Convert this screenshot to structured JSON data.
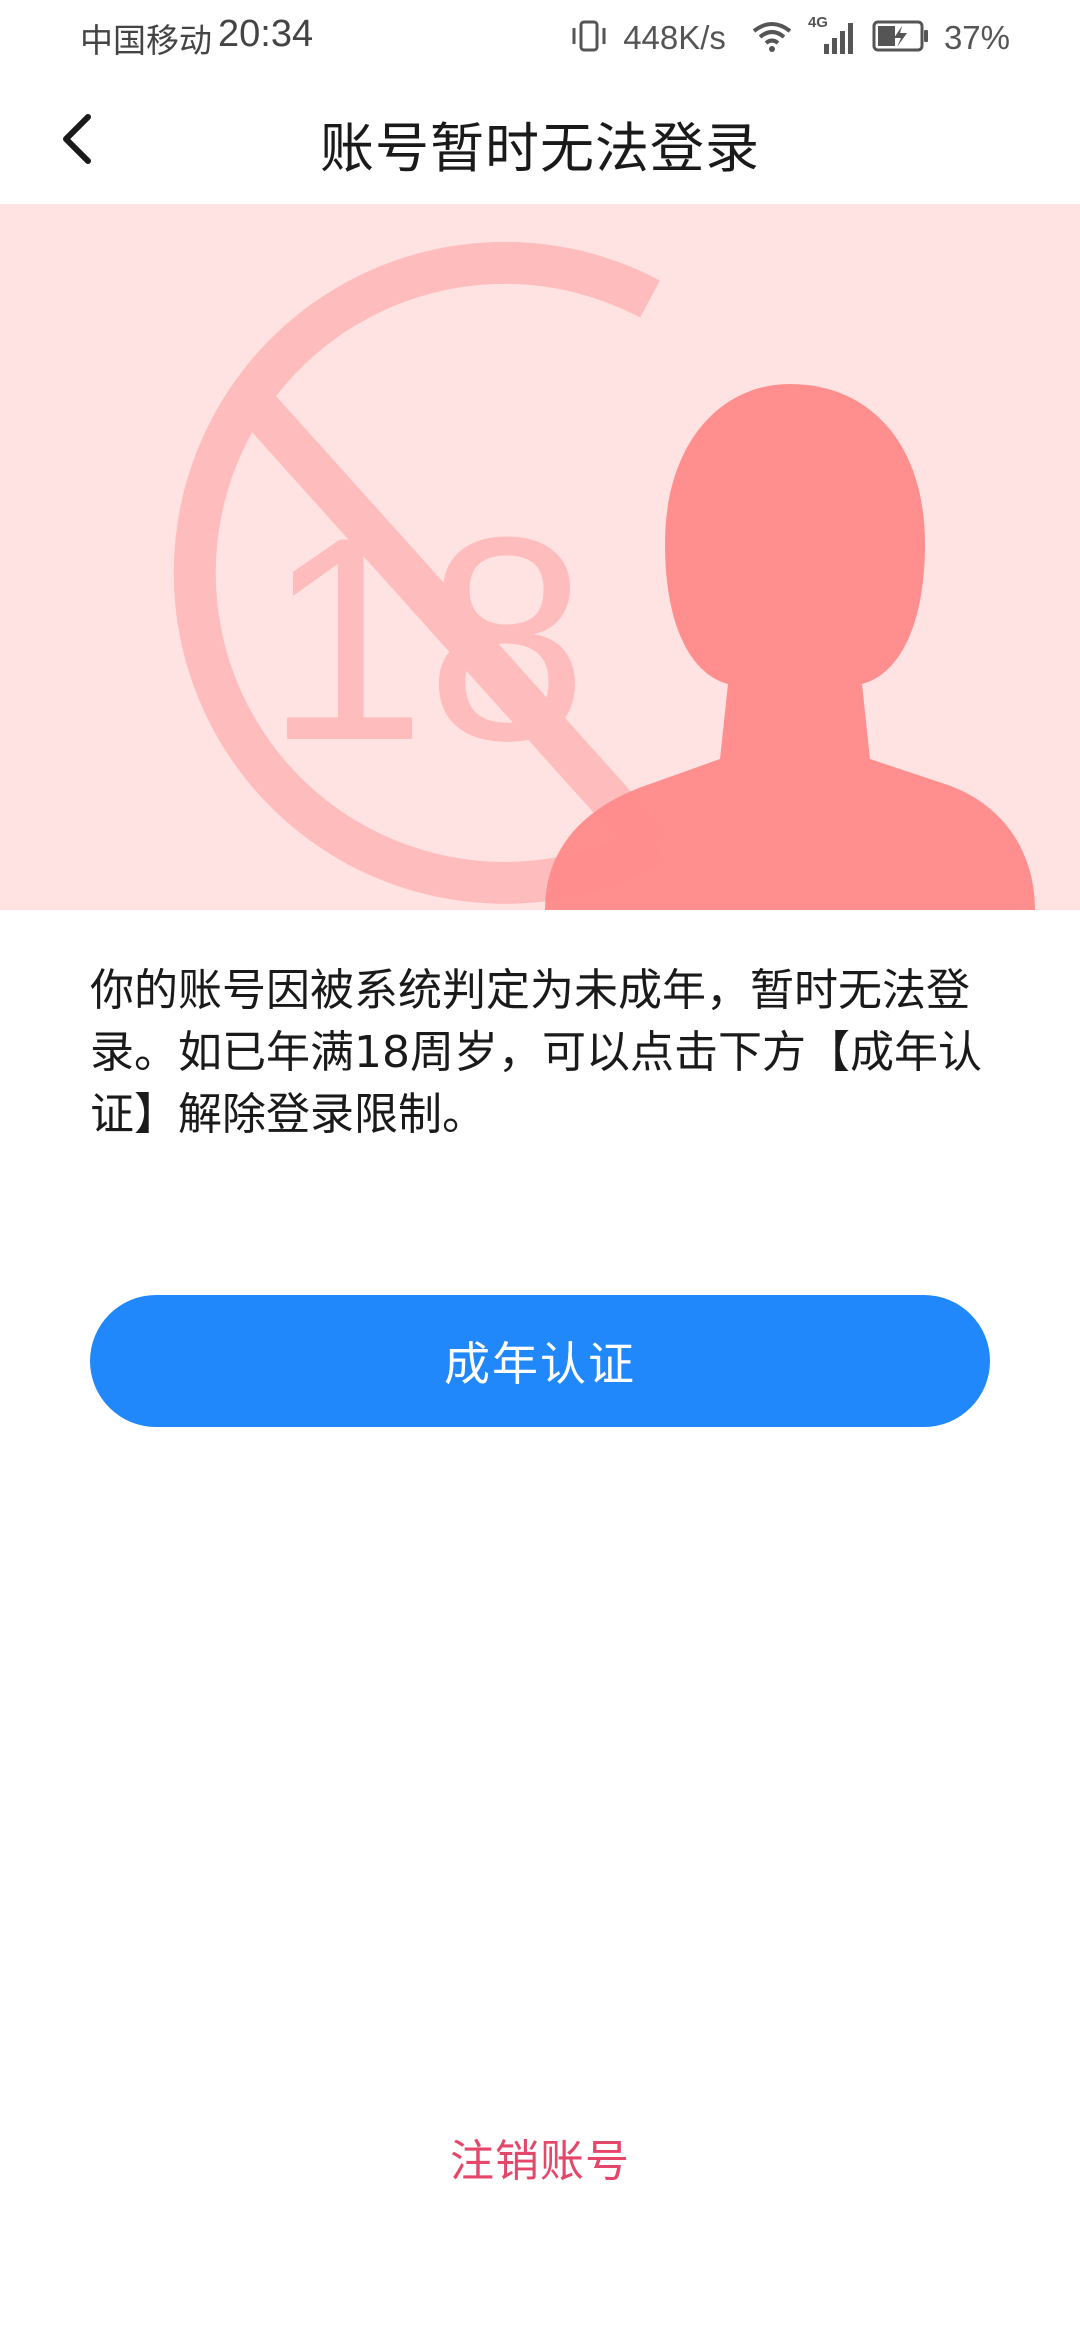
{
  "status_bar": {
    "carrier": "中国移动",
    "time": "20:34",
    "net_speed": "448K/s",
    "network_type": "4G",
    "battery_percent": "37%",
    "icons": [
      "vibrate-icon",
      "wifi-icon",
      "signal-icon",
      "battery-charging-icon"
    ]
  },
  "nav": {
    "title": "账号暂时无法登录",
    "back_icon": "chevron-left-icon"
  },
  "banner": {
    "badge_number": "18",
    "icons": [
      "no-under-18-icon",
      "person-silhouette-icon"
    ],
    "colors": {
      "background": "#ffe3e3",
      "prohibit_sign": "#ffbcbc",
      "silhouette": "#ff8a8a"
    }
  },
  "message": {
    "text": "你的账号因被系统判定为未成年，暂时无法登录。如已年满18周岁，可以点击下方【成年认证】解除登录限制。"
  },
  "actions": {
    "verify_label": "成年认证",
    "cancel_account_label": "注销账号"
  },
  "colors": {
    "primary": "#2188fc",
    "danger_link": "#e5476a"
  }
}
